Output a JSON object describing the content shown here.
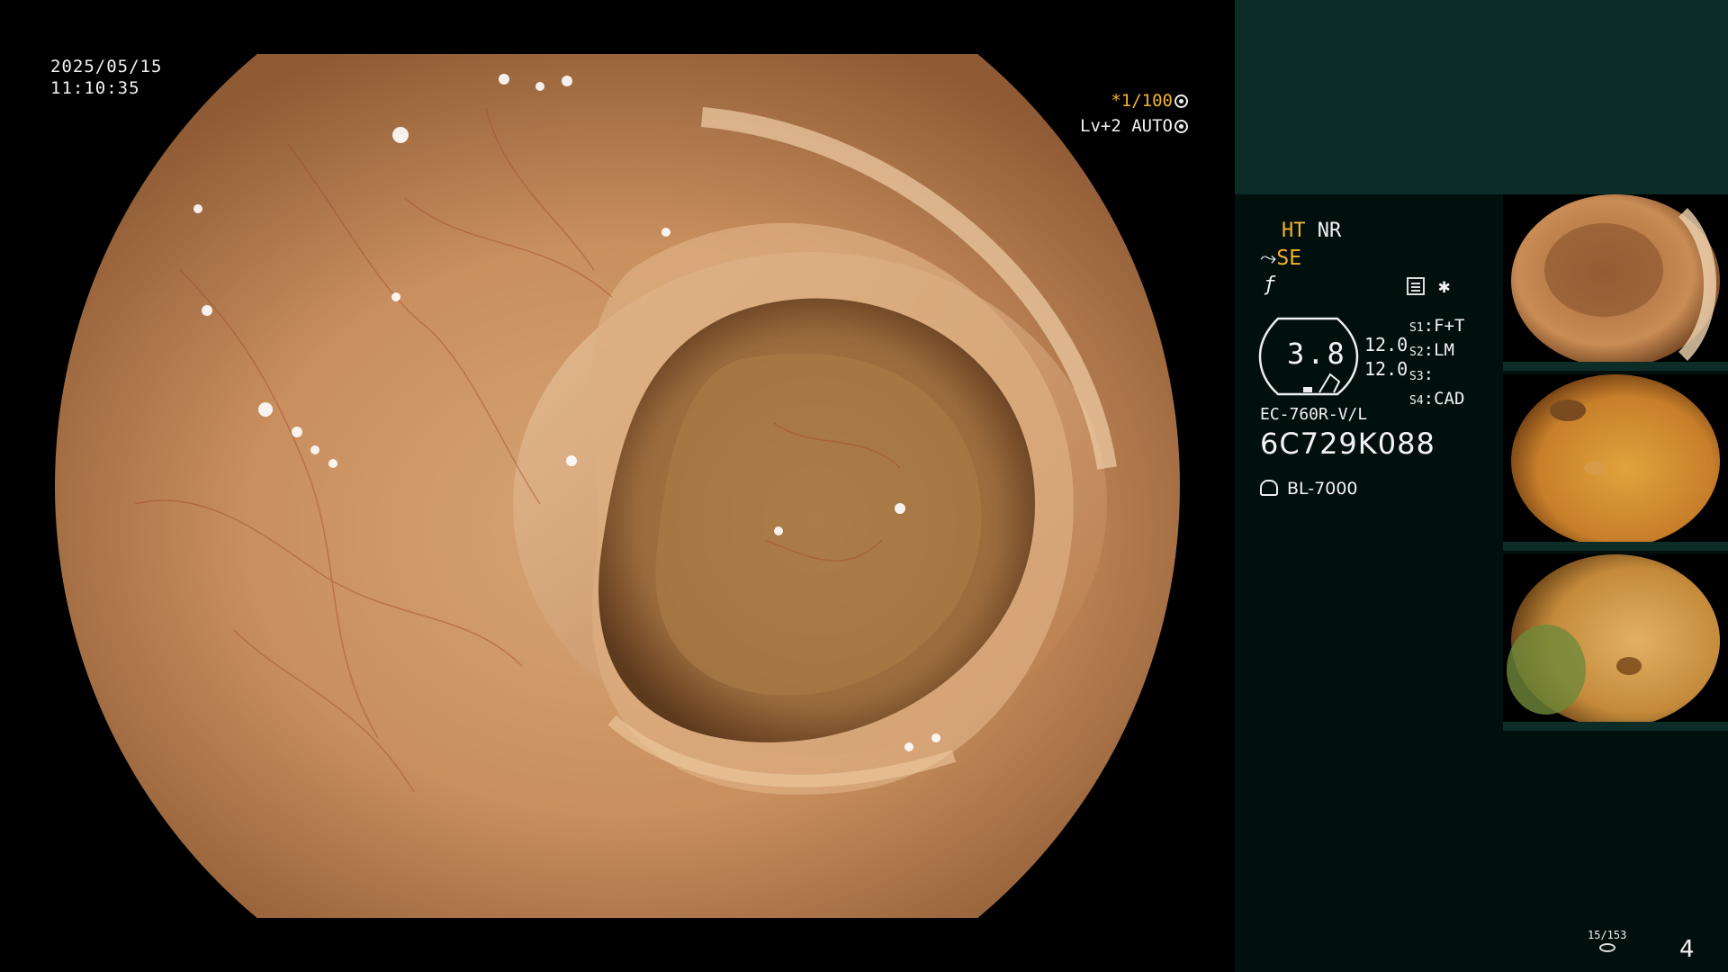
{
  "overlay": {
    "date": "2025/05/15",
    "time": "11:10:35",
    "shutter_mark": "*",
    "shutter": "1/100",
    "iris": "Lv+2 AUTO"
  },
  "panel": {
    "ht": "HT",
    "nr": "NR",
    "se": "SE",
    "zoom_value": "3.8",
    "values": [
      "12.0",
      "12.0"
    ],
    "settings": [
      {
        "slot": "S1",
        "value": "F+T"
      },
      {
        "slot": "S2",
        "value": "LM"
      },
      {
        "slot": "S3",
        "value": ""
      },
      {
        "slot": "S4",
        "value": "CAD"
      }
    ],
    "scope_model": "EC-760R-V/L",
    "serial": "6C729K088",
    "light_source": "BL-7000",
    "capture_count": "15/153",
    "page_number": "4"
  },
  "colors": {
    "accent_yellow": "#f2b230",
    "panel_top": "#0b2c27",
    "panel_bg": "#02100d"
  }
}
